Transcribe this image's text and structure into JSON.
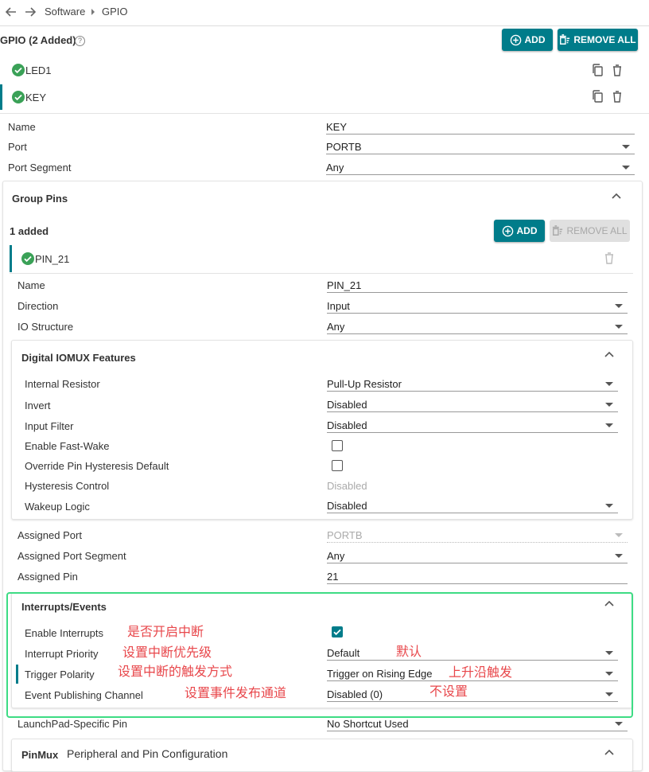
{
  "breadcrumb": {
    "items": [
      "Software",
      "GPIO"
    ]
  },
  "gpio": {
    "title": "GPIO (2 Added)",
    "add_label": "ADD",
    "remove_all_label": "REMOVE ALL",
    "instances": [
      {
        "name": "LED1",
        "selected": false
      },
      {
        "name": "KEY",
        "selected": true
      }
    ],
    "fields": [
      {
        "label": "Name",
        "value": "KEY",
        "type": "text"
      },
      {
        "label": "Port",
        "value": "PORTB",
        "type": "select"
      },
      {
        "label": "Port Segment",
        "value": "Any",
        "type": "select"
      }
    ]
  },
  "group_pins": {
    "title": "Group Pins",
    "added_text": "1 added",
    "add_label": "ADD",
    "remove_all_label": "REMOVE ALL",
    "pin": {
      "name": "PIN_21"
    },
    "fields": [
      {
        "label": "Name",
        "value": "PIN_21",
        "type": "text"
      },
      {
        "label": "Direction",
        "value": "Input",
        "type": "select"
      },
      {
        "label": "IO Structure",
        "value": "Any",
        "type": "select"
      }
    ]
  },
  "iomux": {
    "title": "Digital IOMUX Features",
    "fields": [
      {
        "label": "Internal Resistor",
        "value": "Pull-Up Resistor",
        "type": "select"
      },
      {
        "label": "Invert",
        "value": "Disabled",
        "type": "select"
      },
      {
        "label": "Input Filter",
        "value": "Disabled",
        "type": "select"
      },
      {
        "label": "Enable Fast-Wake",
        "value": "",
        "type": "checkbox",
        "checked": false
      },
      {
        "label": "Override Pin Hysteresis Default",
        "value": "",
        "type": "checkbox",
        "checked": false
      },
      {
        "label": "Hysteresis Control",
        "value": "Disabled",
        "type": "disabled"
      },
      {
        "label": "Wakeup Logic",
        "value": "Disabled",
        "type": "select"
      }
    ]
  },
  "assigned": {
    "fields": [
      {
        "label": "Assigned Port",
        "value": "PORTB",
        "type": "disabled-select"
      },
      {
        "label": "Assigned Port Segment",
        "value": "Any",
        "type": "select"
      },
      {
        "label": "Assigned Pin",
        "value": "21",
        "type": "text"
      }
    ]
  },
  "interrupts": {
    "title": "Interrupts/Events",
    "fields": [
      {
        "label": "Enable Interrupts",
        "value": "",
        "type": "checkbox",
        "checked": true
      },
      {
        "label": "Interrupt Priority",
        "value": "Default",
        "type": "select"
      },
      {
        "label": "Trigger Polarity",
        "value": "Trigger on Rising Edge",
        "type": "select"
      },
      {
        "label": "Event Publishing Channel",
        "value": "Disabled (0)",
        "type": "select"
      }
    ],
    "annotations": [
      "是否开启中断",
      "设置中断优先级",
      "设置中断的触发方式",
      "设置事件发布通道",
      "默认",
      "上升沿触发",
      "不设置"
    ],
    "highlight_color": "#3ddc84"
  },
  "launchpad": {
    "label": "LaunchPad-Specific Pin",
    "value": "No Shortcut Used"
  },
  "pinmux": {
    "title": "PinMux",
    "subtitle": "Peripheral and Pin Configuration"
  },
  "colors": {
    "accent": "#007c8a",
    "check_green": "#3aa157",
    "annotation_red": "#e8474b"
  }
}
